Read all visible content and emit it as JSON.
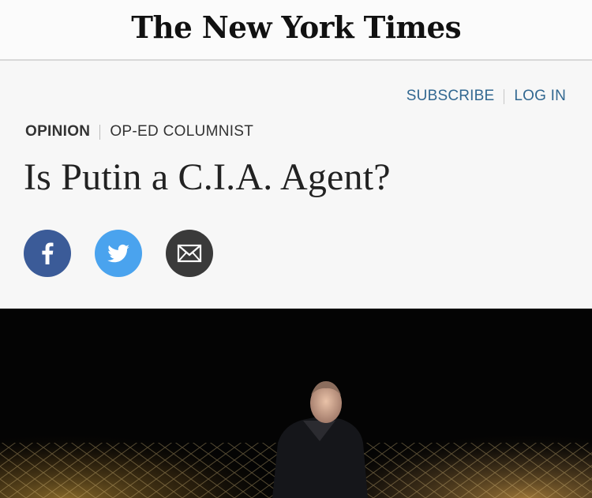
{
  "masthead": {
    "logo_text": "The New York Times"
  },
  "account": {
    "subscribe_label": "SUBSCRIBE",
    "login_label": "LOG IN"
  },
  "kicker": {
    "section": "OPINION",
    "subsection": "OP-ED COLUMNIST"
  },
  "article": {
    "headline": "Is Putin a C.I.A. Agent?"
  },
  "share": {
    "facebook_icon": "facebook-icon",
    "twitter_icon": "twitter-icon",
    "email_icon": "envelope-icon"
  },
  "colors": {
    "link_blue": "#326891",
    "facebook": "#3b5b98",
    "twitter": "#4aa3ee",
    "email": "#3a3a3a"
  }
}
